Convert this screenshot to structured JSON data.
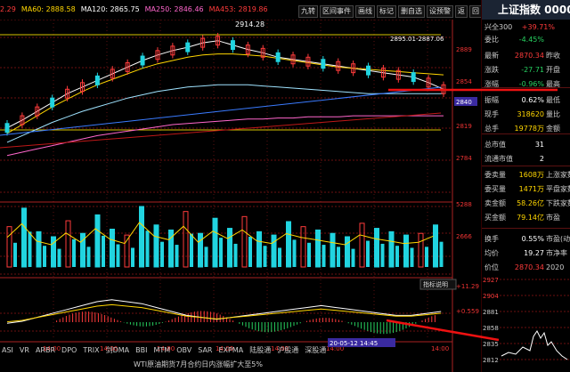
{
  "ma_line": [
    {
      "text": "2.29",
      "color": "#ff3b3b"
    },
    {
      "text": "MA60: 2888.58",
      "color": "#ffd600"
    },
    {
      "text": "MA120: 2865.75",
      "color": "#ffffff"
    },
    {
      "text": "MA250: 2846.46",
      "color": "#ff66cc"
    },
    {
      "text": "MA453: 2819.86",
      "color": "#ff3b3b"
    }
  ],
  "toolbar": [
    "九转",
    "区间事件",
    "画线",
    "标记",
    "删自选",
    "设预警",
    "返",
    "回",
    "扫"
  ],
  "price_axis": [
    "2923",
    "2889",
    "2854",
    "2819",
    "2784",
    "5288",
    "2666",
    "+11.29",
    "+0.559"
  ],
  "price_axis_highlight": "2840",
  "annotations": {
    "high_label": "2914.28",
    "range_label": "2895.01-2887.06",
    "indicator_button": "指标说明",
    "date_marker": "20-05-12 14:45"
  },
  "time_labels": [
    "14:00",
    "14:00",
    "14:00",
    "14:00",
    "14:00",
    "14:00",
    "14:00"
  ],
  "bottom_tabs": [
    "ASI",
    "VR",
    "ARBR",
    "DPO",
    "TRIX",
    "剑DMA",
    "BBI",
    "MTM",
    "OBV",
    "SAR",
    "EXPMA",
    "陆股通",
    "沪股通",
    "深股通"
  ],
  "news": "WTI原油期货7月合约日内涨幅扩大至5%",
  "panel": {
    "title": "上证指数 000001",
    "sub_left": "兴全300",
    "sub_right": "+39.71%",
    "rows": [
      {
        "label": "委比",
        "value": "-4.45%",
        "unit": "",
        "color": "green"
      },
      {
        "label": "最新",
        "value": "2870.34",
        "unit": "昨收",
        "color": "red"
      },
      {
        "label": "涨跌",
        "value": "-27.71",
        "unit": "开盘",
        "color": "green"
      },
      {
        "label": "涨幅",
        "value": "-0.96%",
        "unit": "最高",
        "color": "green"
      },
      {
        "label": "振幅",
        "value": "0.62%",
        "unit": "最低",
        "color": "white"
      },
      {
        "label": "现手",
        "value": "318620",
        "unit": "量比",
        "color": "yellow"
      },
      {
        "label": "总手",
        "value": "19778万",
        "unit": "金额",
        "color": "yellow"
      },
      {
        "label": "总市值",
        "value": "31",
        "unit": "",
        "color": "white"
      },
      {
        "label": "流通市值",
        "value": "2",
        "unit": "",
        "color": "white"
      },
      {
        "label": "委卖量",
        "value": "1608万",
        "unit": "上涨家数",
        "color": "yellow"
      },
      {
        "label": "委买量",
        "value": "1471万",
        "unit": "平盘家数",
        "color": "yellow"
      },
      {
        "label": "卖金额",
        "value": "58.26亿",
        "unit": "下跌家数",
        "color": "yellow"
      },
      {
        "label": "买金额",
        "value": "79.14亿",
        "unit": "市盈",
        "color": "yellow"
      },
      {
        "label": "换手",
        "value": "0.55%",
        "unit": "市盈(动)",
        "color": "white"
      },
      {
        "label": "均价",
        "value": "19.27",
        "unit": "市净率",
        "color": "white"
      }
    ],
    "mini_header": {
      "label": "价位",
      "value": "2870.34",
      "year": "2020"
    },
    "mini_axis": [
      "2927",
      "2904",
      "2881",
      "2858",
      "2835",
      "2812"
    ]
  },
  "chart_data": {
    "type": "line",
    "series": [
      {
        "name": "price",
        "values": [
          2835,
          2842,
          2850,
          2858,
          2866,
          2872,
          2878,
          2884,
          2890,
          2896,
          2901,
          2905,
          2908,
          2912,
          2914,
          2910,
          2906,
          2903,
          2899,
          2897,
          2895,
          2893,
          2891,
          2889,
          2887,
          2885,
          2883,
          2881,
          2876,
          2870
        ]
      },
      {
        "name": "MA60",
        "values": [
          2830,
          2838,
          2846,
          2854,
          2861,
          2868,
          2874,
          2879,
          2884,
          2889,
          2893,
          2896,
          2899,
          2901,
          2902,
          2902,
          2901,
          2900,
          2898,
          2896,
          2894,
          2892,
          2890,
          2889,
          2888,
          2887,
          2886,
          2885,
          2884,
          2883
        ]
      },
      {
        "name": "MA120",
        "values": [
          2822,
          2828,
          2834,
          2840,
          2845,
          2850,
          2854,
          2858,
          2862,
          2865,
          2868,
          2870,
          2872,
          2873,
          2874,
          2874,
          2874,
          2873,
          2872,
          2871,
          2870,
          2869,
          2868,
          2867,
          2866,
          2866,
          2866,
          2866,
          2866,
          2866
        ]
      },
      {
        "name": "MA250",
        "values": [
          2810,
          2813,
          2816,
          2819,
          2822,
          2825,
          2828,
          2830,
          2832,
          2834,
          2836,
          2838,
          2839,
          2840,
          2841,
          2842,
          2843,
          2843,
          2844,
          2844,
          2845,
          2845,
          2845,
          2846,
          2846,
          2846,
          2846,
          2846,
          2846,
          2846
        ]
      }
    ],
    "volume": [
      48,
      70,
      42,
      36,
      55,
      40,
      62,
      45,
      38,
      72,
      50,
      44,
      66,
      40,
      58,
      46,
      60,
      42,
      38,
      54,
      48,
      44,
      40,
      36,
      52,
      46,
      42,
      38,
      40,
      50
    ],
    "macd": [
      -6,
      -5,
      -3,
      -1,
      1,
      3,
      5,
      6,
      5,
      4,
      2,
      0,
      -2,
      -3,
      -4,
      -3,
      -2,
      -1,
      0,
      1,
      2,
      3,
      2,
      1,
      0,
      -1,
      -2,
      -2,
      -1,
      0
    ],
    "ylim": [
      2780,
      2925
    ]
  }
}
